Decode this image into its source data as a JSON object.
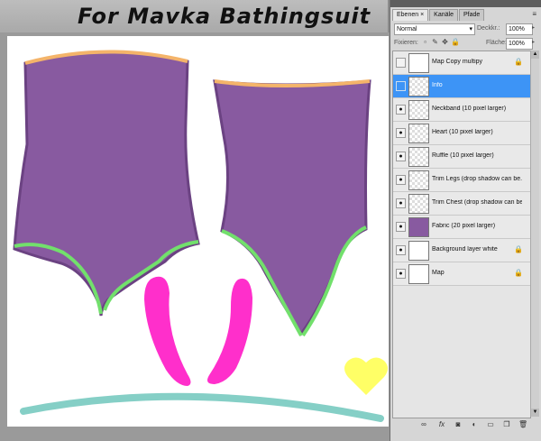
{
  "title": "For Mavka Bathingsuit",
  "panel": {
    "tabs": [
      {
        "label": "Ebenen ×"
      },
      {
        "label": "Kanäle"
      },
      {
        "label": "Pfade"
      }
    ],
    "menu_icon": "panel-menu-icon",
    "blend_mode": "Normal",
    "opacity_label": "Deckkr.:",
    "opacity_value": "100%",
    "lock_label": "Fixieren:",
    "fill_label": "Fläche:",
    "fill_value": "100%",
    "layers": [
      {
        "name": "Map Copy multipy",
        "visible": false,
        "locked": true,
        "selected": false
      },
      {
        "name": "Info",
        "visible": false,
        "locked": false,
        "selected": true
      },
      {
        "name": "Neckband (10 pixel larger)",
        "visible": true,
        "locked": false,
        "selected": false
      },
      {
        "name": "Heart (10 pixel larger)",
        "visible": true,
        "locked": false,
        "selected": false
      },
      {
        "name": "Ruffle (10 pixel larger)",
        "visible": true,
        "locked": false,
        "selected": false
      },
      {
        "name": "Trim Legs (drop shadow can be...",
        "visible": true,
        "locked": false,
        "selected": false
      },
      {
        "name": "Trim Chest (drop shadow can be...",
        "visible": true,
        "locked": false,
        "selected": false
      },
      {
        "name": "Fabric (20 pixel larger)",
        "visible": true,
        "locked": false,
        "selected": false
      },
      {
        "name": "Background layer white",
        "visible": true,
        "locked": true,
        "selected": false
      },
      {
        "name": "Map",
        "visible": true,
        "locked": true,
        "selected": false
      }
    ],
    "footer_icons": [
      "link-icon",
      "fx-icon",
      "mask-icon",
      "adjustment-icon",
      "group-icon",
      "new-layer-icon",
      "trash-icon"
    ]
  },
  "colors": {
    "fabric": "#885aa0",
    "fabric_outline": "#6b4282",
    "chest_trim": "#f4b46a",
    "leg_trim": "#72e06c",
    "ruffle": "#ff2fcb",
    "heart": "#ffff66",
    "neckband": "#85cfc6",
    "selection": "#3d94f6"
  }
}
